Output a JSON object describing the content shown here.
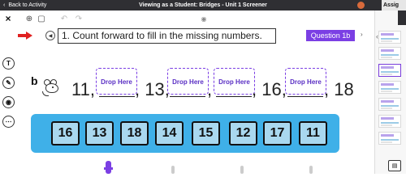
{
  "topbar": {
    "back_label": "Back to Activity",
    "title": "Viewing as a Student: Bridges - Unit 1 Screener",
    "assign_label": "Assig"
  },
  "toolbar": {
    "icons": [
      "close-icon",
      "zoom-icon",
      "fit-screen-icon",
      "undo-icon",
      "redo-icon",
      "eye-icon"
    ]
  },
  "left_tools": {
    "text_tool": "T",
    "icons": [
      "text-icon",
      "pen-icon",
      "camera-icon",
      "more-icon"
    ]
  },
  "question": {
    "instruction": "1. Count forward to fill in the missing numbers.",
    "badge": "Question 1b",
    "sequence_label": "b",
    "sequence": [
      "11,",
      ", 13,",
      ",",
      ", 16,",
      ", 18"
    ],
    "drop_label": "Drop Here"
  },
  "tiles": [
    "16",
    "13",
    "18",
    "14",
    "15",
    "12",
    "17",
    "11"
  ],
  "colors": {
    "accent_purple": "#7b3fe4",
    "strip_blue": "#3fb0e8",
    "tile_fill": "#a9d8ef",
    "arrow_red": "#e02020",
    "topbar_dark": "#2f2f33"
  }
}
